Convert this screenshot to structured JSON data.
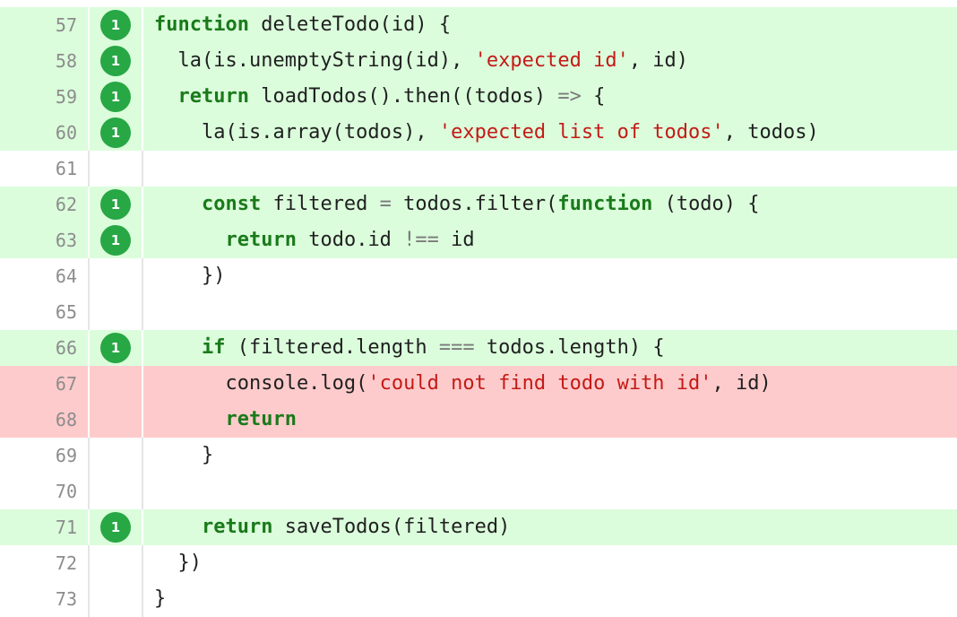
{
  "lines": [
    {
      "num": "57",
      "status": "covered",
      "hits": "1",
      "tokens": [
        {
          "t": "kw",
          "v": "function"
        },
        {
          "t": "plain",
          "v": " deleteTodo(id) {"
        }
      ]
    },
    {
      "num": "58",
      "status": "covered",
      "hits": "1",
      "tokens": [
        {
          "t": "plain",
          "v": "  la(is.unemptyString(id), "
        },
        {
          "t": "str",
          "v": "'expected id'"
        },
        {
          "t": "plain",
          "v": ", id)"
        }
      ]
    },
    {
      "num": "59",
      "status": "covered",
      "hits": "1",
      "tokens": [
        {
          "t": "plain",
          "v": "  "
        },
        {
          "t": "kw",
          "v": "return"
        },
        {
          "t": "plain",
          "v": " loadTodos().then((todos) "
        },
        {
          "t": "op",
          "v": "=>"
        },
        {
          "t": "plain",
          "v": " {"
        }
      ]
    },
    {
      "num": "60",
      "status": "covered",
      "hits": "1",
      "tokens": [
        {
          "t": "plain",
          "v": "    la(is.array(todos), "
        },
        {
          "t": "str",
          "v": "'expected list of todos'"
        },
        {
          "t": "plain",
          "v": ", todos)"
        }
      ]
    },
    {
      "num": "61",
      "status": "neutral",
      "hits": "",
      "tokens": []
    },
    {
      "num": "62",
      "status": "covered",
      "hits": "1",
      "tokens": [
        {
          "t": "plain",
          "v": "    "
        },
        {
          "t": "kw",
          "v": "const"
        },
        {
          "t": "plain",
          "v": " filtered "
        },
        {
          "t": "op",
          "v": "="
        },
        {
          "t": "plain",
          "v": " todos.filter("
        },
        {
          "t": "kw",
          "v": "function"
        },
        {
          "t": "plain",
          "v": " (todo) {"
        }
      ]
    },
    {
      "num": "63",
      "status": "covered",
      "hits": "1",
      "tokens": [
        {
          "t": "plain",
          "v": "      "
        },
        {
          "t": "kw",
          "v": "return"
        },
        {
          "t": "plain",
          "v": " todo.id "
        },
        {
          "t": "op",
          "v": "!=="
        },
        {
          "t": "plain",
          "v": " id"
        }
      ]
    },
    {
      "num": "64",
      "status": "neutral",
      "hits": "",
      "tokens": [
        {
          "t": "plain",
          "v": "    })"
        }
      ]
    },
    {
      "num": "65",
      "status": "neutral",
      "hits": "",
      "tokens": []
    },
    {
      "num": "66",
      "status": "covered",
      "hits": "1",
      "tokens": [
        {
          "t": "plain",
          "v": "    "
        },
        {
          "t": "kw",
          "v": "if"
        },
        {
          "t": "plain",
          "v": " (filtered.length "
        },
        {
          "t": "op",
          "v": "==="
        },
        {
          "t": "plain",
          "v": " todos.length) {"
        }
      ]
    },
    {
      "num": "67",
      "status": "uncovered",
      "hits": "",
      "tokens": [
        {
          "t": "plain",
          "v": "      console.log("
        },
        {
          "t": "str",
          "v": "'could not find todo with id'"
        },
        {
          "t": "plain",
          "v": ", id)"
        }
      ]
    },
    {
      "num": "68",
      "status": "uncovered",
      "hits": "",
      "tokens": [
        {
          "t": "plain",
          "v": "      "
        },
        {
          "t": "kw",
          "v": "return"
        }
      ]
    },
    {
      "num": "69",
      "status": "neutral",
      "hits": "",
      "tokens": [
        {
          "t": "plain",
          "v": "    }"
        }
      ]
    },
    {
      "num": "70",
      "status": "neutral",
      "hits": "",
      "tokens": []
    },
    {
      "num": "71",
      "status": "covered",
      "hits": "1",
      "tokens": [
        {
          "t": "plain",
          "v": "    "
        },
        {
          "t": "kw",
          "v": "return"
        },
        {
          "t": "plain",
          "v": " saveTodos(filtered)"
        }
      ]
    },
    {
      "num": "72",
      "status": "neutral",
      "hits": "",
      "tokens": [
        {
          "t": "plain",
          "v": "  })"
        }
      ]
    },
    {
      "num": "73",
      "status": "neutral",
      "hits": "",
      "tokens": [
        {
          "t": "plain",
          "v": "}"
        }
      ]
    }
  ]
}
